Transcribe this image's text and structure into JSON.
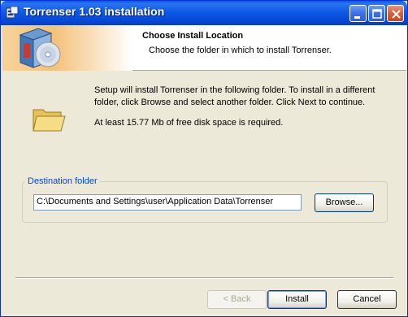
{
  "window": {
    "title": "Torrenser 1.03 installation",
    "icon": "installer-app-icon",
    "controls": [
      "minimize-icon",
      "maximize-icon",
      "close-icon"
    ]
  },
  "header": {
    "title": "Choose Install Location",
    "subtitle": "Choose the folder in which to install Torrenser."
  },
  "body": {
    "description": "Setup will install Torrenser in the following folder. To install in a different folder, click Browse and select another folder. Click Next to continue.",
    "space_required": "At least 15.77 Mb of free disk space is required."
  },
  "destination": {
    "group_label": "Destination folder",
    "path": "C:\\Documents and Settings\\user\\Application Data\\Torrenser",
    "browse_label": "Browse..."
  },
  "buttons": {
    "back_label": "< Back",
    "install_label": "Install",
    "cancel_label": "Cancel"
  },
  "colors": {
    "titlebar": "#0a5be0",
    "dialog_bg": "#ece9d8",
    "group_label": "#0046d5"
  }
}
